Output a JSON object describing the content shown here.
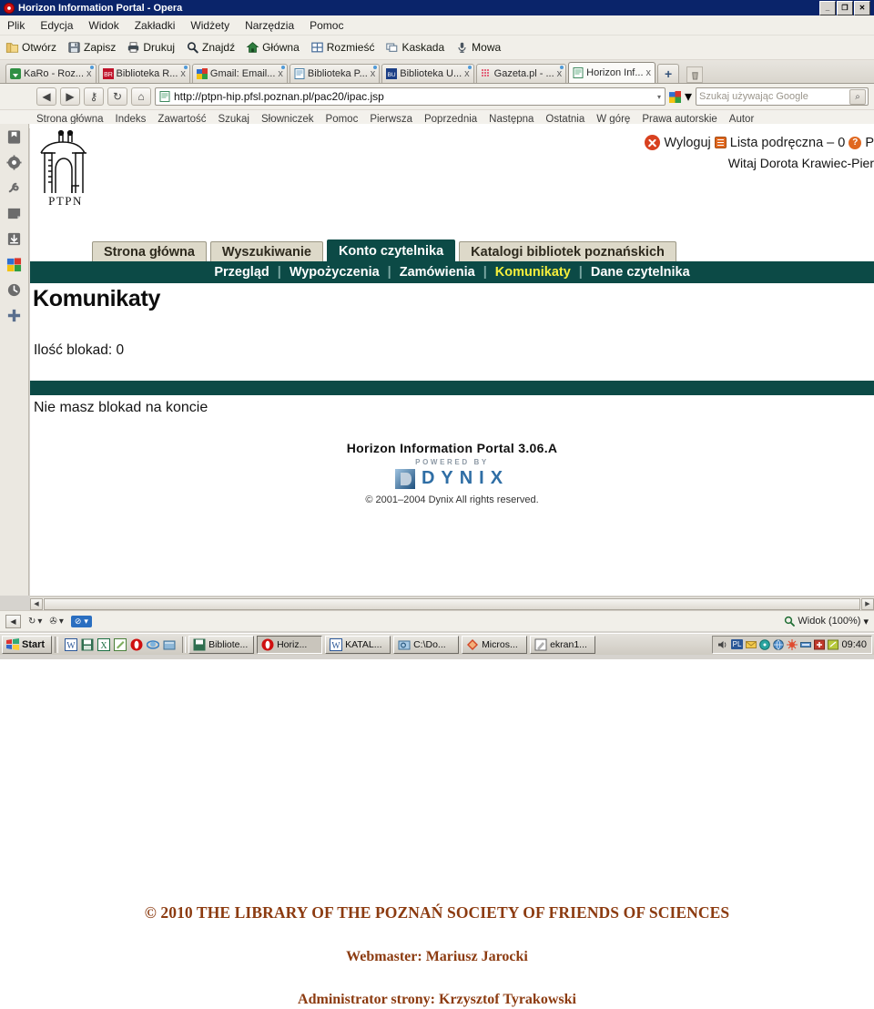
{
  "window": {
    "title": "Horizon Information Portal - Opera",
    "minimize": "_",
    "restore": "❐",
    "close": "✕"
  },
  "menubar": [
    "Plik",
    "Edycja",
    "Widok",
    "Zakładki",
    "Widżety",
    "Narzędzia",
    "Pomoc"
  ],
  "toolbar": [
    {
      "label": "Otwórz",
      "icon": "folder-icon"
    },
    {
      "label": "Zapisz",
      "icon": "floppy-icon"
    },
    {
      "label": "Drukuj",
      "icon": "printer-icon"
    },
    {
      "label": "Znajdź",
      "icon": "search-icon"
    },
    {
      "label": "Główna",
      "icon": "home-icon"
    },
    {
      "label": "Rozmieść",
      "icon": "tile-icon"
    },
    {
      "label": "Kaskada",
      "icon": "cascade-icon"
    },
    {
      "label": "Mowa",
      "icon": "microphone-icon"
    }
  ],
  "tabs": [
    {
      "label": "KaRo - Roz...",
      "icon": "karo-icon",
      "active": false,
      "close": "x"
    },
    {
      "label": "Biblioteka R...",
      "icon": "br-icon",
      "active": false,
      "close": "x"
    },
    {
      "label": "Gmail: Email...",
      "icon": "gmail-icon",
      "active": false,
      "close": "x"
    },
    {
      "label": "Biblioteka P...",
      "icon": "page-icon",
      "active": false,
      "close": "x"
    },
    {
      "label": "Biblioteka U...",
      "icon": "bu-icon",
      "active": false,
      "close": "x"
    },
    {
      "label": "Gazeta.pl - ...",
      "icon": "gazeta-icon",
      "active": false,
      "close": "x"
    },
    {
      "label": "Horizon Inf...",
      "icon": "page-icon",
      "active": true,
      "close": "x"
    }
  ],
  "tab_new_label": "+",
  "address": {
    "back": "◀",
    "forward": "▶",
    "key": "⚷",
    "reload": "↻",
    "home": "⌂",
    "url": "http://ptpn-hip.pfsl.poznan.pl/pac20/ipac.jsp",
    "dropdown": "▾",
    "search_placeholder": "Szukaj używając Google",
    "search_value": "",
    "search_engine": "google-icon",
    "search_submit": "⌕"
  },
  "hip_links": [
    "Strona główna",
    "Indeks",
    "Zawartość",
    "Szukaj",
    "Słowniczek",
    "Pomoc",
    "Pierwsza",
    "Poprzednia",
    "Następna",
    "Ostatnia",
    "W górę",
    "Prawa autorskie",
    "Autor"
  ],
  "panel_icons": [
    "bookmarks-icon",
    "widgets-icon",
    "links-icon",
    "notes-icon",
    "downloads-icon",
    "google-icon",
    "history-icon",
    "add-panel-icon"
  ],
  "page": {
    "logo_caption": "PTPN",
    "account_bar": {
      "logout": "Wyloguj",
      "list": "Lista podręczna – 0",
      "help_truncated": "P"
    },
    "welcome": "Witaj Dorota Krawiec-Pier",
    "tabs": [
      {
        "label": "Strona główna",
        "active": false
      },
      {
        "label": "Wyszukiwanie",
        "active": false
      },
      {
        "label": "Konto czytelnika",
        "active": true
      },
      {
        "label": "Katalogi bibliotek poznańskich",
        "active": false
      }
    ],
    "subnav": [
      {
        "label": "Przegląd",
        "selected": false
      },
      {
        "label": "Wypożyczenia",
        "selected": false
      },
      {
        "label": "Zamówienia",
        "selected": false
      },
      {
        "label": "Komunikaty",
        "selected": true
      },
      {
        "label": "Dane czytelnika",
        "selected": false
      }
    ],
    "title": "Komunikaty",
    "block_count": "Ilość blokad: 0",
    "no_locks": "Nie masz blokad na koncie",
    "dynix": {
      "product": "Horizon Information Portal 3.06.A",
      "powered_by": "POWERED BY",
      "wordmark": "DYNIX",
      "copyright": "© 2001–2004 Dynix All rights reserved."
    }
  },
  "statusbar": {
    "panel_toggle": "◀",
    "sync": "↻",
    "transfer": "✇",
    "blocked": "⊘",
    "view_label": "Widok (100%)",
    "view_caret": "▾",
    "zoom_icon": "magnifier-icon"
  },
  "taskbar": {
    "start": "Start",
    "quicklaunch": [
      "word-icon",
      "save-icon",
      "excel-icon",
      "editor-icon",
      "opera-icon",
      "ie-icon",
      "explorer-icon"
    ],
    "buttons": [
      {
        "label": "Bibliote...",
        "icon": "save-icon",
        "pressed": false
      },
      {
        "label": "Horiz...",
        "icon": "opera-icon",
        "pressed": true
      },
      {
        "label": "KATAL...",
        "icon": "word-icon",
        "pressed": false
      },
      {
        "label": "C:\\Do...",
        "icon": "explorer-icon",
        "pressed": false
      },
      {
        "label": "Micros...",
        "icon": "ppt-icon",
        "pressed": false
      },
      {
        "label": "ekran1...",
        "icon": "paint-icon",
        "pressed": false
      }
    ],
    "tray_lang": "PL",
    "clock": "09:40"
  },
  "footer": {
    "line1": "© 2010 THE LIBRARY OF THE POZNAŃ SOCIETY OF FRIENDS OF SCIENCES",
    "line2": "Webmaster: Mariusz Jarocki",
    "line3": "Administrator strony: Krzysztof Tyrakowski"
  },
  "colors": {
    "titlebar": "#0a246a",
    "teal": "#0c4a46",
    "tab_inactive": "#ddd9c9",
    "highlight_yellow": "#f5ef3c",
    "footer_brown": "#8c3b10",
    "accent_orange": "#d8411f"
  }
}
